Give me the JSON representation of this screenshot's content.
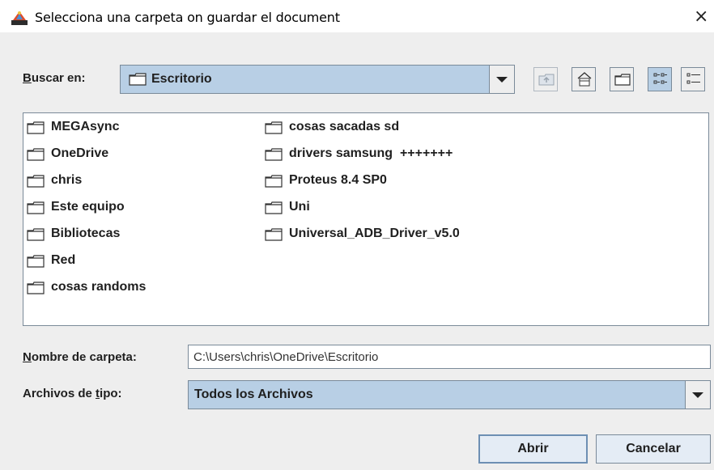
{
  "window": {
    "title": "Selecciona una carpeta on guardar el document",
    "close_glyph": "×"
  },
  "toolbar": {
    "look_in_label_mnemonic": "B",
    "look_in_label_rest": "uscar en:",
    "current_folder": "Escritorio",
    "buttons": [
      "up-one-level-icon",
      "home-icon",
      "new-folder-icon",
      "list-view-icon",
      "details-view-icon"
    ]
  },
  "files": {
    "column1": [
      "MEGAsync",
      "OneDrive",
      "chris",
      "Este equipo",
      "Bibliotecas",
      "Red",
      "cosas randoms"
    ],
    "column2": [
      "cosas sacadas sd",
      "drivers samsung  +++++++",
      "Proteus 8.4 SP0",
      "Uni",
      "Universal_ADB_Driver_v5.0"
    ]
  },
  "filename": {
    "label_mnemonic": "N",
    "label_rest": "ombre de carpeta:",
    "value": "C:\\Users\\chris\\OneDrive\\Escritorio"
  },
  "filetype": {
    "label_start": "Archivos de ",
    "label_mnemonic": "t",
    "label_rest": "ipo:",
    "value": "Todos los Archivos"
  },
  "buttons": {
    "open": "Abrir",
    "cancel": "Cancelar"
  },
  "colors": {
    "selection": "#b8cfe5",
    "panel_background": "#eeeeee",
    "border": "#7a8a99"
  }
}
